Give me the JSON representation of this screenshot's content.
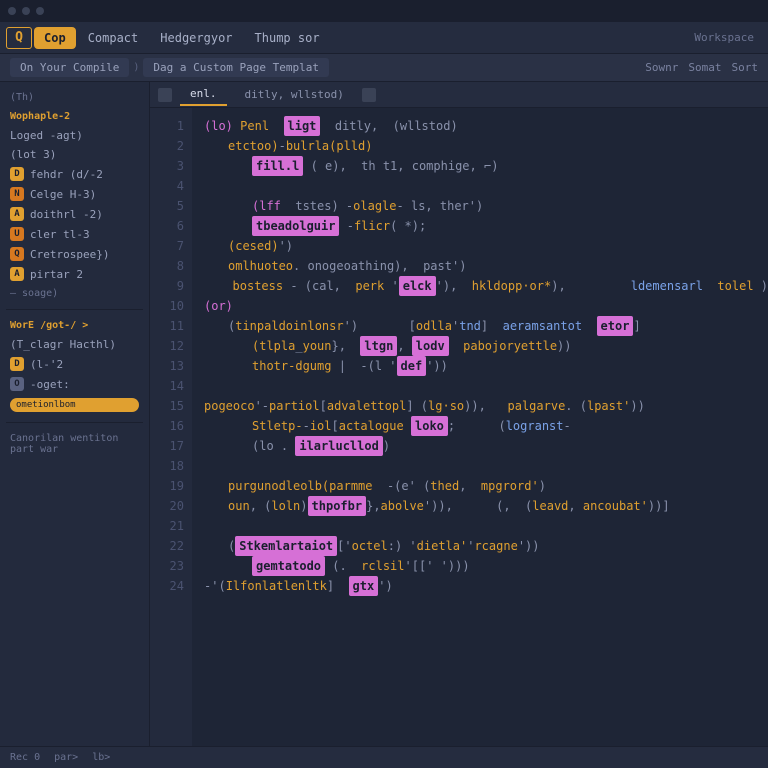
{
  "window": {
    "logo": "Q"
  },
  "menubar": {
    "primary": "Cop",
    "items": [
      "Compact",
      "Hedgergyor",
      "Thump sor"
    ],
    "right": [
      "Workspace"
    ]
  },
  "breadcrumb": {
    "chips": [
      "On Your Compile",
      ")",
      "Dag a Custom Page Templat"
    ],
    "actions": [
      "Sownr",
      "Somat",
      "Sort"
    ]
  },
  "sidebar": {
    "section_top": "(Th)",
    "section1": "Wophaple-2",
    "items": [
      {
        "icon": "",
        "label": "Loged -agt)"
      },
      {
        "icon": "",
        "label": "(lot 3)"
      },
      {
        "icon": "D",
        "cls": "ic-y",
        "label": "fehdr (d/-2"
      },
      {
        "icon": "N",
        "cls": "ic-o",
        "label": "Celge H-3)"
      },
      {
        "icon": "A",
        "cls": "ic-y",
        "label": "doithrl  -2)"
      },
      {
        "icon": "U",
        "cls": "ic-o",
        "label": "cler tl-3"
      },
      {
        "icon": "Q",
        "cls": "ic-o",
        "label": "Cretrospee})"
      },
      {
        "icon": "A",
        "cls": "ic-y",
        "label": "pirtar 2"
      }
    ],
    "sub1": "— soage)",
    "section2": "WorE  /got-/ >",
    "item_b1": {
      "icon": "",
      "label": "(T_clagr Hacthl)"
    },
    "item_b2": {
      "icon": "D",
      "cls": "ic-y",
      "label": "(l-'2"
    },
    "item_b3": {
      "icon": "O",
      "cls": "ic-g",
      "label": "-oget:"
    },
    "badge": "ometionlbom",
    "footer": "Canorilan wentiton   part war"
  },
  "editor": {
    "tabs": [
      "enl.",
      "ditly, wllstod)"
    ],
    "lines": [
      {
        "ind": 0,
        "parts": [
          [
            "k",
            "(lo)"
          ],
          [
            "p",
            " "
          ],
          [
            "f",
            "Penl"
          ],
          [
            "p",
            "  "
          ],
          [
            "kh",
            "ligt"
          ],
          [
            "p",
            "  ditly,  (wllstod)"
          ]
        ]
      },
      {
        "ind": 1,
        "parts": [
          [
            "f",
            "etctoo)"
          ],
          [
            "p",
            "-"
          ],
          [
            "f",
            "bulrla(plld)"
          ]
        ]
      },
      {
        "ind": 2,
        "parts": [
          [
            "kh",
            "fill.l"
          ],
          [
            "p",
            " ( e),  th t1, comphige, ⌐)"
          ]
        ]
      },
      {
        "ind": 0,
        "parts": [
          [
            "p",
            ""
          ]
        ]
      },
      {
        "ind": 2,
        "parts": [
          [
            "k",
            "(lff"
          ],
          [
            "p",
            "  tstes) -"
          ],
          [
            "f",
            "olagle"
          ],
          [
            "p",
            "- ls, ther')"
          ]
        ]
      },
      {
        "ind": 2,
        "parts": [
          [
            "kh",
            "tbeadolguir"
          ],
          [
            "p",
            " -"
          ],
          [
            "f",
            "flicr"
          ],
          [
            "p",
            "( *);"
          ]
        ]
      },
      {
        "ind": 1,
        "parts": [
          [
            "f",
            "(cesed)"
          ],
          [
            "p",
            "')"
          ]
        ]
      },
      {
        "ind": 1,
        "parts": [
          [
            "f",
            "omlhuoteo"
          ],
          [
            "p",
            ". onogeoathing),  past')"
          ]
        ]
      },
      {
        "ind": 2,
        "parts": [
          [
            "f",
            "bostess"
          ],
          [
            "p",
            " - (cal,  "
          ],
          [
            "f",
            "perk"
          ],
          [
            "p",
            " '"
          ],
          [
            "kh",
            "elck"
          ],
          [
            "p",
            "'),  "
          ],
          [
            "f",
            "hkldopp·or*"
          ],
          [
            "p",
            "),         "
          ],
          [
            "n",
            "ldemensarl"
          ],
          [
            "p",
            "  "
          ],
          [
            "f",
            "tolel"
          ],
          [
            "p",
            " )"
          ]
        ]
      },
      {
        "ind": 0,
        "parts": [
          [
            "k",
            "(or)"
          ]
        ]
      },
      {
        "ind": 1,
        "parts": [
          [
            "p",
            "("
          ],
          [
            "f",
            "tinpaldoinlonsr"
          ],
          [
            "p",
            "')"
          ],
          [
            "p",
            "       ["
          ],
          [
            "f",
            "odlla"
          ],
          [
            "p",
            "'"
          ],
          [
            "n",
            "tnd"
          ],
          [
            "p",
            "]  "
          ],
          [
            "n",
            "aeramsantot"
          ],
          [
            "p",
            "  "
          ],
          [
            "kh",
            "etor"
          ],
          [
            "p",
            "]"
          ]
        ]
      },
      {
        "ind": 2,
        "parts": [
          [
            "f",
            "(tlpla"
          ],
          [
            "p",
            "_"
          ],
          [
            "f",
            "youn"
          ],
          [
            "p",
            "},  "
          ],
          [
            "kh",
            "ltgn"
          ],
          [
            "p",
            ", "
          ],
          [
            "kh",
            "lodv"
          ],
          [
            "p",
            "  "
          ],
          [
            "f",
            "pabojoryettle"
          ],
          [
            "p",
            "))"
          ]
        ]
      },
      {
        "ind": 2,
        "parts": [
          [
            "f",
            "thotr-dgumg"
          ],
          [
            "p",
            " |  -(l '"
          ],
          [
            "kh",
            "def"
          ],
          [
            "p",
            "'))"
          ]
        ]
      },
      {
        "ind": 0,
        "parts": [
          [
            "p",
            ""
          ]
        ]
      },
      {
        "ind": 0,
        "parts": [
          [
            "f",
            "pogeoco"
          ],
          [
            "p",
            "'-"
          ],
          [
            "f",
            "partiol"
          ],
          [
            "p",
            "["
          ],
          [
            "f",
            "advalettopl"
          ],
          [
            "p",
            "] ("
          ],
          [
            "f",
            "lg·so"
          ],
          [
            "p",
            ")),   "
          ],
          [
            "f",
            "palgarve"
          ],
          [
            "p",
            ". ("
          ],
          [
            "f",
            "lpast'"
          ],
          [
            "p",
            "))"
          ]
        ]
      },
      {
        "ind": 2,
        "parts": [
          [
            "f",
            "Stletp-"
          ],
          [
            "p",
            "-"
          ],
          [
            "f",
            "iol"
          ],
          [
            "p",
            "["
          ],
          [
            "f",
            "actalogue"
          ],
          [
            "p",
            " "
          ],
          [
            "kh",
            "loko"
          ],
          [
            "p",
            ";      ("
          ],
          [
            "n",
            "logranst"
          ],
          [
            "p",
            "-"
          ]
        ]
      },
      {
        "ind": 2,
        "parts": [
          [
            "p",
            "(lo . "
          ],
          [
            "kh",
            "ilarlucllod"
          ],
          [
            "p",
            ")"
          ]
        ]
      },
      {
        "ind": 0,
        "parts": [
          [
            "p",
            ""
          ]
        ]
      },
      {
        "ind": 1,
        "parts": [
          [
            "f",
            "purgunodleolb(parmme"
          ],
          [
            "p",
            "  -(e' ("
          ],
          [
            "f",
            "thed"
          ],
          [
            "p",
            ",  "
          ],
          [
            "f",
            "mpgrord'"
          ],
          [
            "p",
            ")"
          ]
        ]
      },
      {
        "ind": 1,
        "parts": [
          [
            "f",
            "oun"
          ],
          [
            "p",
            ", ("
          ],
          [
            "f",
            "loln"
          ],
          [
            "p",
            ")"
          ],
          [
            "kh",
            "thpofbr"
          ],
          [
            "p",
            "},"
          ],
          [
            "f",
            "abolve"
          ],
          [
            "p",
            "')),      (,  ("
          ],
          [
            "f",
            "leavd"
          ],
          [
            "p",
            ", "
          ],
          [
            "f",
            "ancoubat'"
          ],
          [
            "p",
            "))]"
          ]
        ]
      },
      {
        "ind": 0,
        "parts": [
          [
            "p",
            ""
          ]
        ]
      },
      {
        "ind": 1,
        "parts": [
          [
            "p",
            "("
          ],
          [
            "kh",
            "Stkemlartaiot"
          ],
          [
            "p",
            "['"
          ],
          [
            "f",
            "octel"
          ],
          [
            "p",
            ":) '"
          ],
          [
            "f",
            "dietla'"
          ],
          [
            "p",
            "'"
          ],
          [
            "f",
            "rcagne"
          ],
          [
            "p",
            "'))"
          ]
        ]
      },
      {
        "ind": 2,
        "parts": [
          [
            "kh",
            "gemtatodo"
          ],
          [
            "p",
            " (.  "
          ],
          [
            "f",
            "rclsil"
          ],
          [
            "p",
            "'[[' ')))"
          ]
        ]
      },
      {
        "ind": 0,
        "parts": [
          [
            "p",
            "-'("
          ],
          [
            "f",
            "Ilfonlatlenltk"
          ],
          [
            "p",
            "]  "
          ],
          [
            "kh",
            "gtx"
          ],
          [
            "p",
            "')"
          ]
        ]
      }
    ]
  },
  "statusbar": {
    "items": [
      "Rec 0",
      "par>",
      "lb>"
    ]
  }
}
